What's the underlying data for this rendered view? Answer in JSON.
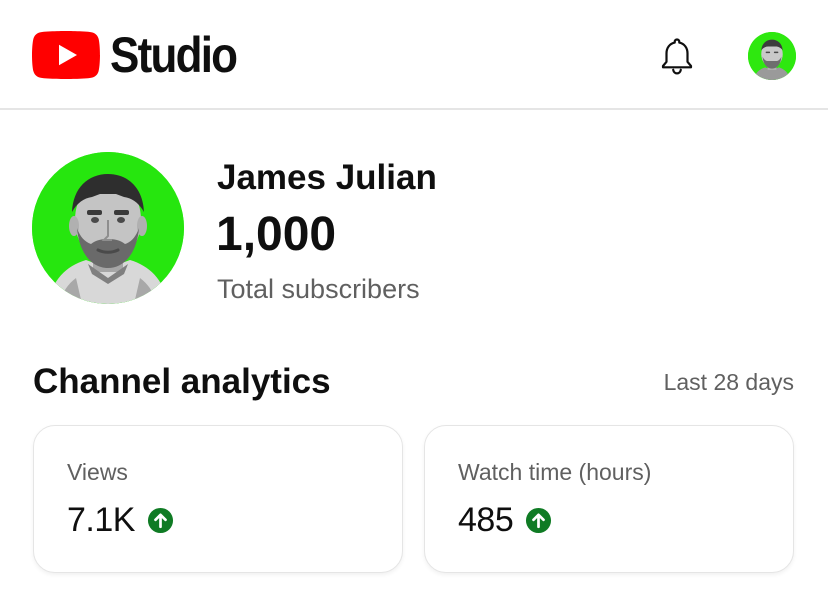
{
  "header": {
    "app_name": "Studio",
    "logo_icon": "youtube-play-logo",
    "notifications_icon": "bell-icon",
    "brand_color": "#ff0000"
  },
  "profile": {
    "channel_name": "James Julian",
    "subscriber_count": "1,000",
    "subscriber_label": "Total subscribers",
    "avatar_bg_color": "#26e60e"
  },
  "analytics": {
    "title": "Channel analytics",
    "period": "Last 28 days",
    "cards": [
      {
        "label": "Views",
        "value": "7.1K",
        "trend": "up",
        "trend_icon": "arrow-up-circle-icon",
        "trend_color": "#0f7b24"
      },
      {
        "label": "Watch time (hours)",
        "value": "485",
        "trend": "up",
        "trend_icon": "arrow-up-circle-icon",
        "trend_color": "#0f7b24"
      }
    ]
  }
}
